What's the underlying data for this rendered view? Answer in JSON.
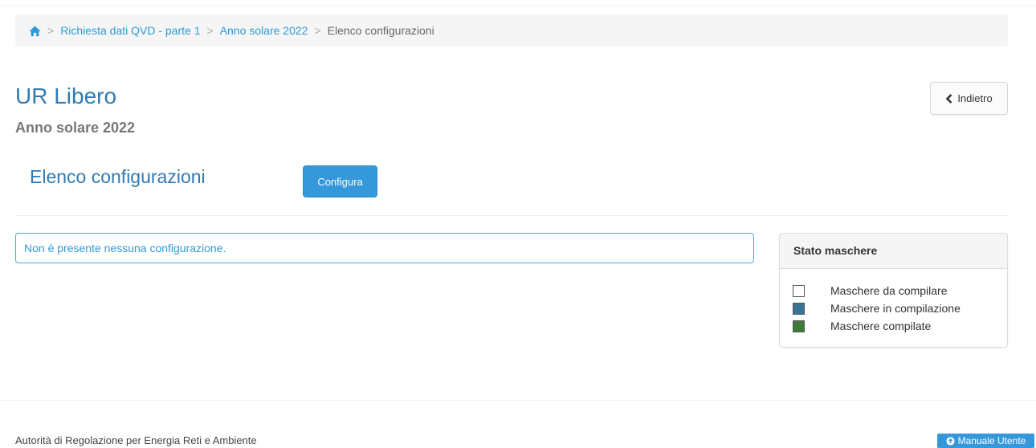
{
  "breadcrumb": {
    "home_icon": "home-icon",
    "items": [
      {
        "label": "Richiesta dati QVD - parte 1"
      },
      {
        "label": "Anno solare 2022"
      }
    ],
    "current": "Elenco configurazioni",
    "separator": ">"
  },
  "header": {
    "title": "UR Libero",
    "subtitle": "Anno solare 2022",
    "back_label": "Indietro"
  },
  "section": {
    "title": "Elenco configurazioni",
    "configure_label": "Configura"
  },
  "alert": {
    "text": "Non è presente nessuna configurazione."
  },
  "legend": {
    "heading": "Stato maschere",
    "items": [
      {
        "label": "Maschere da compilare",
        "color": "#ffffff"
      },
      {
        "label": "Maschere in compilazione",
        "color": "#3b7396"
      },
      {
        "label": "Maschere compilate",
        "color": "#3d7a3c"
      }
    ]
  },
  "footer": {
    "org": "Autorità di Regolazione per Energia Reti e Ambiente",
    "manual_label": "Manuale Utente"
  },
  "colors": {
    "accent": "#3498db",
    "title": "#317ab0",
    "link": "#2e9ad6"
  }
}
